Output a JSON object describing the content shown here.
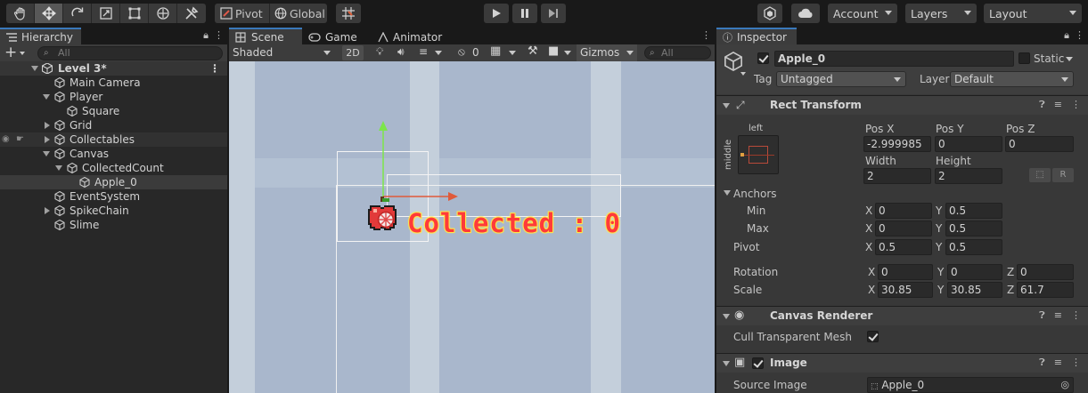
{
  "toolbar": {
    "pivot_label": "Pivot",
    "global_label": "Global",
    "account_label": "Account",
    "layers_label": "Layers",
    "layout_label": "Layout"
  },
  "hierarchy": {
    "tab_label": "Hierarchy",
    "add_label": "+",
    "search_placeholder": "All",
    "items": [
      {
        "label": "Level 3*"
      },
      {
        "label": "Main Camera"
      },
      {
        "label": "Player"
      },
      {
        "label": "Square"
      },
      {
        "label": "Grid"
      },
      {
        "label": "Collectables"
      },
      {
        "label": "Canvas"
      },
      {
        "label": "CollectedCount"
      },
      {
        "label": "Apple_0"
      },
      {
        "label": "EventSystem"
      },
      {
        "label": "SpikeChain"
      },
      {
        "label": "Slime"
      }
    ]
  },
  "scene": {
    "tabs": [
      "Scene",
      "Game",
      "Animator"
    ],
    "shading": "Shaded",
    "mode_2d": "2D",
    "hidden_count": "0",
    "gizmos_label": "Gizmos",
    "search_placeholder": "All",
    "collected_text": "Collected : 0"
  },
  "inspector": {
    "tab_label": "Inspector",
    "object_name": "Apple_0",
    "static_label": "Static",
    "tag_label": "Tag",
    "tag_value": "Untagged",
    "layer_label": "Layer",
    "layer_value": "Default",
    "rect_transform": {
      "title": "Rect Transform",
      "anchor_top": "left",
      "anchor_side": "middle",
      "pos_x_label": "Pos X",
      "pos_x": "-2.999985",
      "pos_y_label": "Pos Y",
      "pos_y": "0",
      "pos_z_label": "Pos Z",
      "pos_z": "0",
      "width_label": "Width",
      "width": "2",
      "height_label": "Height",
      "height": "2",
      "r_label": "R",
      "anchors_label": "Anchors",
      "min_label": "Min",
      "min_x": "0",
      "min_y": "0.5",
      "max_label": "Max",
      "max_x": "0",
      "max_y": "0.5",
      "pivot_label": "Pivot",
      "pivot_x": "0.5",
      "pivot_y": "0.5",
      "rotation_label": "Rotation",
      "rot_x": "0",
      "rot_y": "0",
      "rot_z": "0",
      "scale_label": "Scale",
      "scale_x": "30.85",
      "scale_y": "30.85",
      "scale_z": "61.7",
      "x": "X",
      "y": "Y",
      "z": "Z"
    },
    "canvas_renderer": {
      "title": "Canvas Renderer",
      "cull_label": "Cull Transparent Mesh"
    },
    "image": {
      "title": "Image",
      "source_label": "Source Image",
      "source_value": "Apple_0"
    }
  },
  "colors": {
    "accent": "#3a79bb",
    "scene_light": "#c0ccd8",
    "scene_dark": "#a7b7cc",
    "text_fill": "#ff3a3a",
    "text_outline": "#ffe94a"
  }
}
